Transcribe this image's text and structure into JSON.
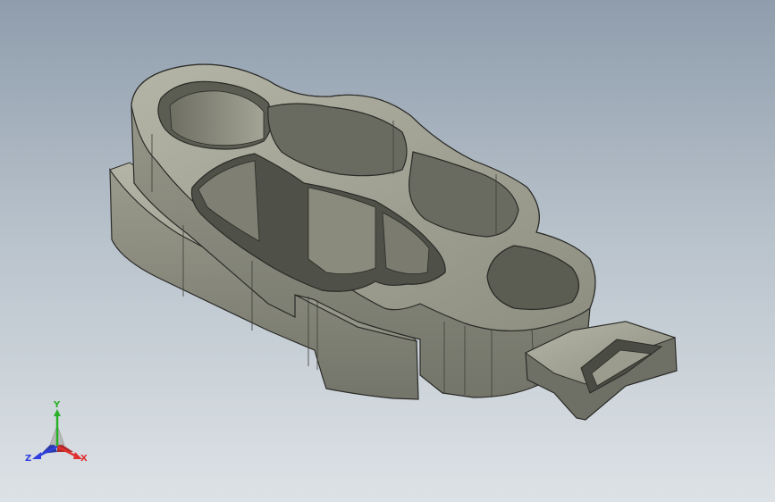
{
  "colors": {
    "background_top": "#8f9dac",
    "background_bottom": "#dde2e6",
    "body_face": "#8f9080",
    "body_top": "#a0a192",
    "body_shadow": "#5b5c50",
    "edge": "#2b2b28",
    "axis_x": "#e03030",
    "axis_y": "#28b028",
    "axis_z": "#3040e0"
  },
  "triad": {
    "x_label": "X",
    "y_label": "Y",
    "z_label": "Z"
  }
}
